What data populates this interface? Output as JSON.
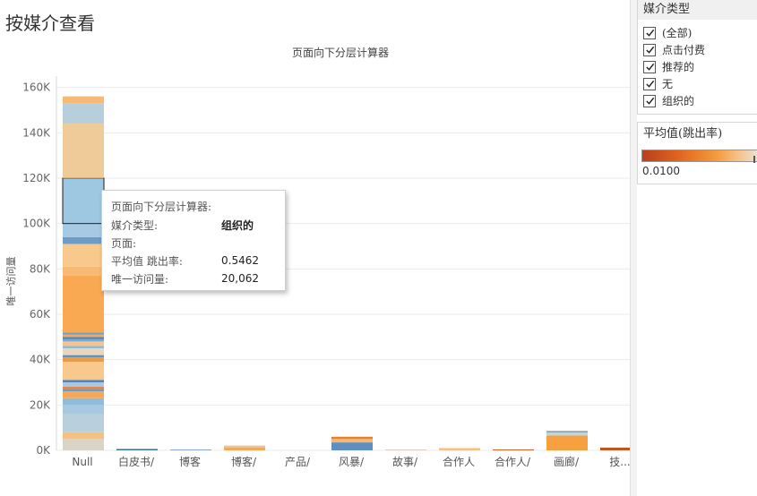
{
  "dashboard": {
    "title": "按媒介查看"
  },
  "chart_data": {
    "type": "bar",
    "subtype": "stacked",
    "title": "页面向下分层计算器",
    "ylabel": "唯一访问量",
    "xlabel": "",
    "ylim": [
      0,
      165000
    ],
    "yticks": [
      0,
      20000,
      40000,
      60000,
      80000,
      100000,
      120000,
      140000,
      160000
    ],
    "ytick_labels": [
      "0K",
      "20K",
      "40K",
      "60K",
      "80K",
      "100K",
      "120K",
      "140K",
      "160K"
    ],
    "grid": true,
    "categories": [
      "Null",
      "白皮书/",
      "博客",
      "博客/",
      "产品/",
      "风暴/",
      "故事/",
      "合作人",
      "合作人/",
      "画廊/",
      "技..."
    ],
    "color_by": "平均值(跳出率)",
    "stacks": [
      {
        "category": "Null",
        "segments": [
          {
            "value": 5000,
            "color": "#d9d4c7"
          },
          {
            "value": 3000,
            "color": "#f6c07f"
          },
          {
            "value": 8000,
            "color": "#b9d0dc"
          },
          {
            "value": 4000,
            "color": "#a6c8e0"
          },
          {
            "value": 3000,
            "color": "#8fbcdd"
          },
          {
            "value": 3000,
            "color": "#f4a858"
          },
          {
            "value": 1000,
            "color": "#6a9ccc"
          },
          {
            "value": 1000,
            "color": "#e8823a"
          },
          {
            "value": 2000,
            "color": "#a9c9e2"
          },
          {
            "value": 1000,
            "color": "#4f86be"
          },
          {
            "value": 1000,
            "color": "#f7c48c"
          },
          {
            "value": 7000,
            "color": "#f9c88d"
          },
          {
            "value": 2000,
            "color": "#f09a40"
          },
          {
            "value": 1000,
            "color": "#5f93c6"
          },
          {
            "value": 3000,
            "color": "#e8d6bd"
          },
          {
            "value": 1000,
            "color": "#8fb9dc"
          },
          {
            "value": 2000,
            "color": "#f7c48c"
          },
          {
            "value": 1000,
            "color": "#7aaad4"
          },
          {
            "value": 1000,
            "color": "#4d86bd"
          },
          {
            "value": 1000,
            "color": "#f4a858"
          },
          {
            "value": 1000,
            "color": "#6a9fcf"
          },
          {
            "value": 25000,
            "color": "#f9a952"
          },
          {
            "value": 4000,
            "color": "#f6ba76"
          },
          {
            "value": 10000,
            "color": "#f9c88d"
          },
          {
            "value": 3000,
            "color": "#6a9ccc"
          },
          {
            "value": 6000,
            "color": "#a6c9e4"
          },
          {
            "value": 20062,
            "color": "#9ec7e2",
            "highlight": true
          },
          {
            "value": 24000,
            "color": "#f0cb9a"
          },
          {
            "value": 9000,
            "color": "#b7cfda"
          },
          {
            "value": 3000,
            "color": "#f6b978"
          }
        ]
      },
      {
        "category": "白皮书/",
        "segments": [
          {
            "value": 600,
            "color": "#3f6f9c"
          }
        ]
      },
      {
        "category": "博客",
        "segments": [
          {
            "value": 300,
            "color": "#6a93b8"
          }
        ]
      },
      {
        "category": "博客/",
        "segments": [
          {
            "value": 1300,
            "color": "#f4a858"
          },
          {
            "value": 800,
            "color": "#d9c7a8"
          }
        ]
      },
      {
        "category": "产品/",
        "segments": []
      },
      {
        "category": "风暴/",
        "segments": [
          {
            "value": 3500,
            "color": "#5f8fc0"
          },
          {
            "value": 1500,
            "color": "#f6b86d"
          },
          {
            "value": 1000,
            "color": "#e8802d"
          }
        ]
      },
      {
        "category": "故事/",
        "segments": [
          {
            "value": 400,
            "color": "#d9cfc2"
          }
        ]
      },
      {
        "category": "合作人",
        "segments": [
          {
            "value": 1000,
            "color": "#f6c07f"
          }
        ]
      },
      {
        "category": "合作人/",
        "segments": [
          {
            "value": 400,
            "color": "#d8632b"
          }
        ]
      },
      {
        "category": "画廊/",
        "segments": [
          {
            "value": 6500,
            "color": "#f7a040"
          },
          {
            "value": 1500,
            "color": "#c4d4d8"
          },
          {
            "value": 500,
            "color": "#6f8a95"
          }
        ]
      },
      {
        "category": "技...",
        "segments": [
          {
            "value": 1200,
            "color": "#c4541f"
          }
        ]
      }
    ]
  },
  "tooltip": {
    "title": "页面向下分层计算器:",
    "rows": [
      {
        "key": "媒介类型:",
        "value": "组织的"
      },
      {
        "key": "页面:",
        "value": ""
      },
      {
        "key": "平均值 跳出率:",
        "value": "0.5462"
      },
      {
        "key": "唯一访问量:",
        "value": "20,062"
      }
    ]
  },
  "filter": {
    "title": "媒介类型",
    "items": [
      {
        "label": "(全部)",
        "checked": true
      },
      {
        "label": "点击付费",
        "checked": true
      },
      {
        "label": "推荐的",
        "checked": true
      },
      {
        "label": "无",
        "checked": true
      },
      {
        "label": "组织的",
        "checked": true
      }
    ]
  },
  "legend": {
    "title": "平均值(跳出率)",
    "min_label": "0.0100"
  },
  "colors": {
    "scrollbar_thumb": "#cdcdcd",
    "grid": "#ebebeb"
  }
}
